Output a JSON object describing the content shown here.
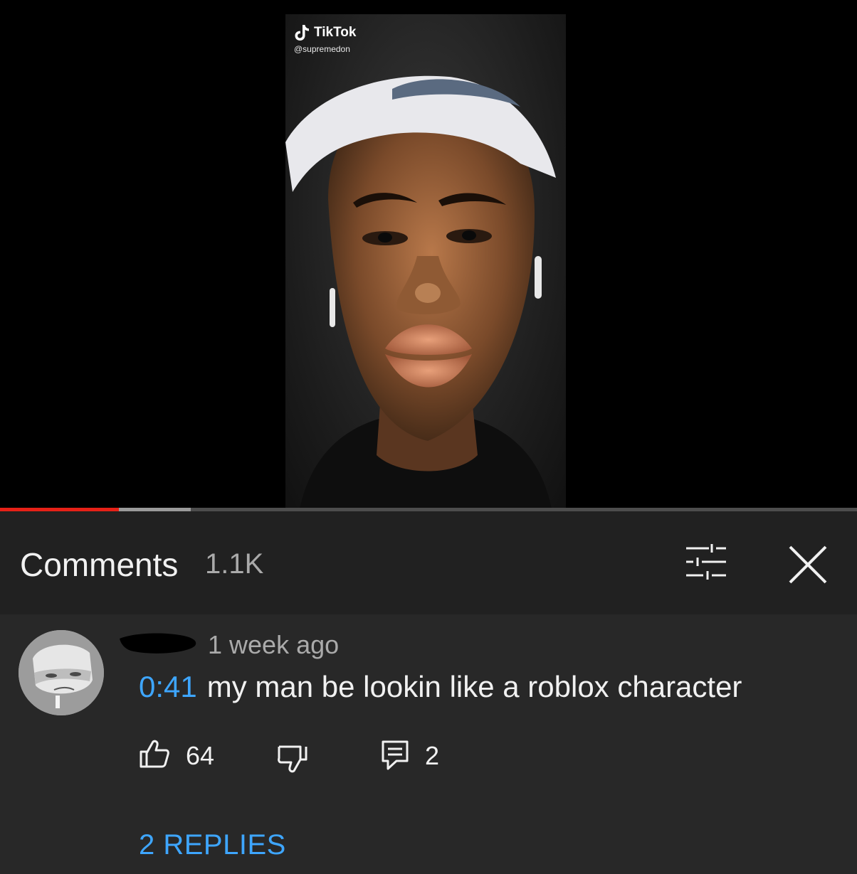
{
  "video": {
    "watermark_brand": "TikTok",
    "watermark_handle": "@supremedon",
    "progress_played": 0.139,
    "progress_buffered": 0.223
  },
  "comments": {
    "title": "Comments",
    "count": "1.1K",
    "icons": {
      "sort": "sort-sliders-icon",
      "close": "close-icon"
    }
  },
  "comment": {
    "author": "",
    "time": "1 week ago",
    "timestamp": "0:41",
    "text": "my man be lookin like a roblox character",
    "likes": "64",
    "replies_count": "2",
    "replies_label": "2 REPLIES",
    "icons": {
      "like": "thumbs-up-icon",
      "dislike": "thumbs-down-icon",
      "reply": "reply-icon"
    }
  },
  "colors": {
    "accent_link": "#3ea6ff",
    "progress_red": "#e62117",
    "panel_bg": "#282828",
    "header_bg": "#212121"
  }
}
